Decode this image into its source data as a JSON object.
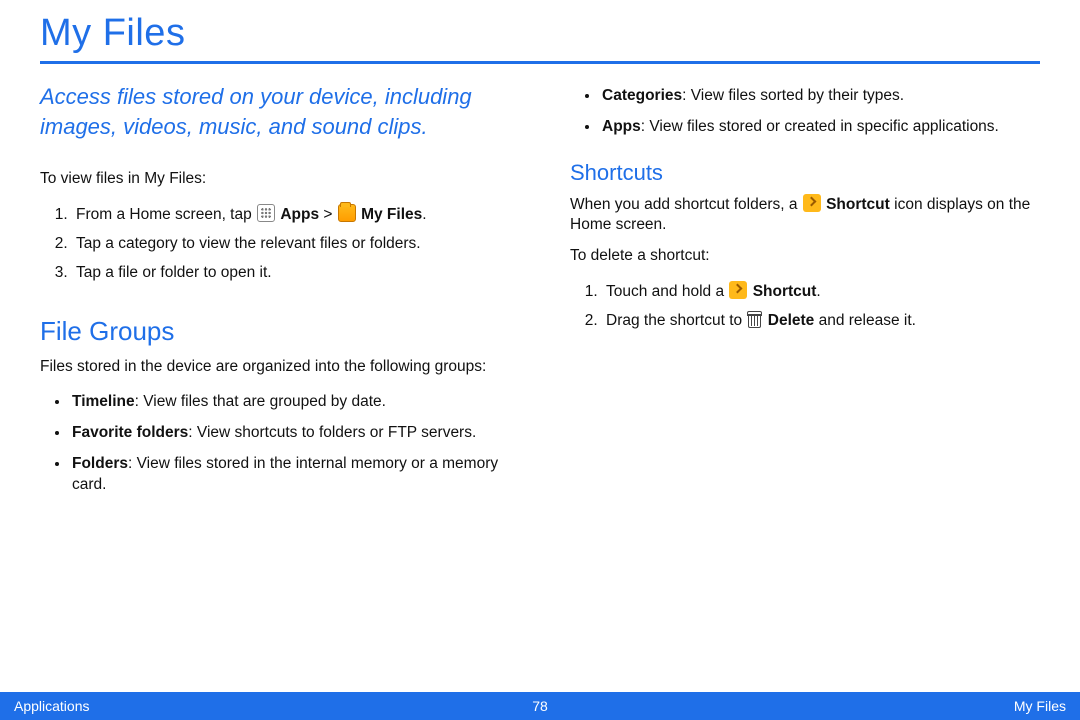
{
  "title": "My Files",
  "intro": "Access files stored on your device, including images, videos, music, and sound clips.",
  "viewLead": "To view files in My Files:",
  "step1_a": "From a Home screen, tap ",
  "step1_apps": "Apps",
  "step1_sep": " > ",
  "step1_myfiles": "My Files",
  "step1_end": ".",
  "step2": "Tap a category to view the relevant files or folders.",
  "step3": "Tap a file or folder to open it.",
  "fileGroupsHeading": "File Groups",
  "fileGroupsLead": "Files stored in the device are organized into the following groups:",
  "fg_timeline_b": "Timeline",
  "fg_timeline_t": ": View files that are grouped by date.",
  "fg_fav_b": "Favorite folders",
  "fg_fav_t": ": View shortcuts to folders or FTP servers.",
  "fg_folders_b": "Folders",
  "fg_folders_t": ": View files stored in the internal memory or a memory card.",
  "fg_cat_b": "Categories",
  "fg_cat_t": ": View files sorted by their types.",
  "fg_apps_b": "Apps",
  "fg_apps_t": ": View files stored or created in specific applications.",
  "shortcutsHeading": "Shortcuts",
  "sc_p1_a": "When you add shortcut folders, a ",
  "sc_p1_b": "Shortcut",
  "sc_p1_c": " icon displays on the Home screen.",
  "sc_lead": "To delete a shortcut:",
  "sc_s1_a": "Touch and hold a ",
  "sc_s1_b": "Shortcut",
  "sc_s1_c": ".",
  "sc_s2_a": "Drag the shortcut to ",
  "sc_s2_b": "Delete",
  "sc_s2_c": "  and release it.",
  "footer": {
    "left": "Applications",
    "center": "78",
    "right": "My Files"
  }
}
